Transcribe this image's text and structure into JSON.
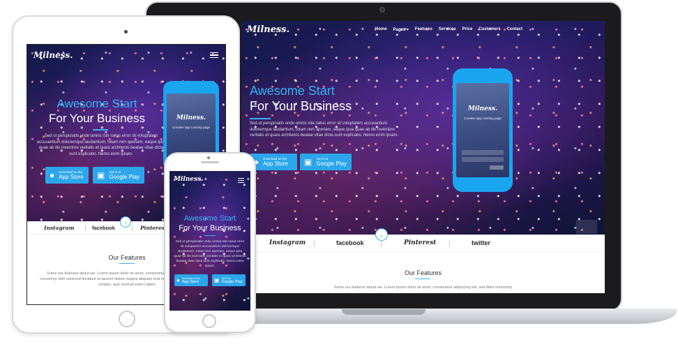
{
  "brand": {
    "logo": "Milness.",
    "accent": "#36b3f0",
    "button_color": "#2ba6ea"
  },
  "nav": {
    "items": [
      "Home",
      "Pages",
      "Features",
      "Services",
      "Price",
      "Customers",
      "Contact"
    ]
  },
  "hero": {
    "title_line1": "Awesome Start",
    "title_line2": "For Your Business",
    "paragraph": "Sed ut perspiciatis unde omnis iste natus error sit voluptatem accusantium doloremque laudantium, totam rem aperiam, eaque ipsa quae ab illo inventore veritatis et quasi architecto beatae vitae dicta sunt explicabo. Nemo enim ipsam.",
    "app_store": {
      "small": "Download on the",
      "big": "App Store",
      "icon": "apple-icon"
    },
    "google_play": {
      "small": "Get it on",
      "big": "Google Play",
      "icon": "android-icon"
    }
  },
  "phone_mockup": {
    "logo": "Milness.",
    "subtitle": "Creative app Landing page"
  },
  "social": [
    "Instagram",
    "facebook",
    "Pinterest",
    "twitter"
  ],
  "features": {
    "title": "Our Features",
    "text": "Some our features about we. Lorem ipsum dolor sit amet, consectetur adipiscing elit, sed diam nonummy nibh euismod tincidunt ut laoreet dolore magna aliquam erat volutpat. Ut wisi enim ad minim veniam, quis nostrud exerci tation",
    "text_short": "Some our features about we. Lorem ipsum dolor sit amet, consectetur adipiscing elit, sed diam nonummy"
  }
}
